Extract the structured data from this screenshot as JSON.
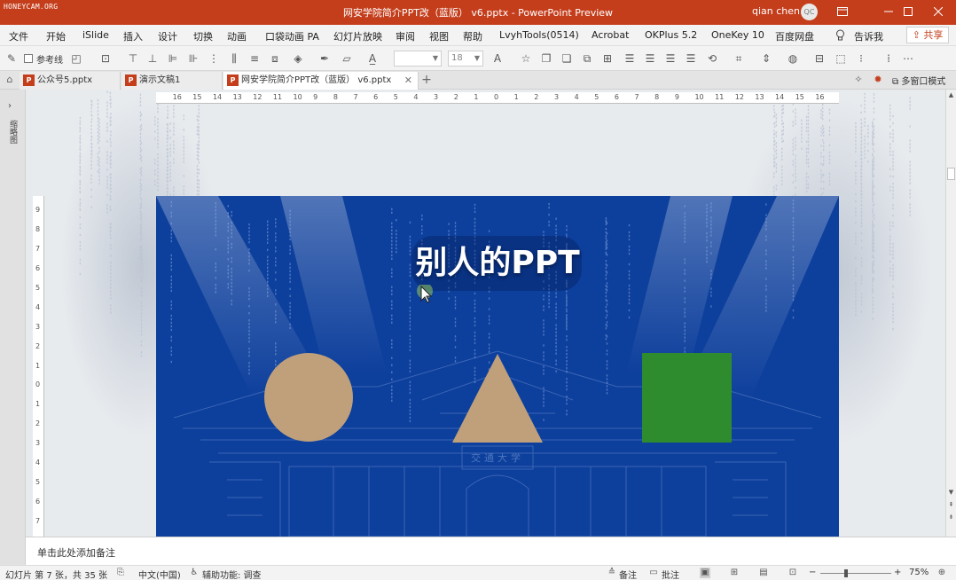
{
  "brand_text": "HONEYCAM.ORG",
  "window": {
    "title": "网安学院简介PPT改（蓝版） v6.pptx - PowerPoint Preview",
    "user": "qian chen",
    "avatar": "QC",
    "min_icon": "minimize-icon",
    "max_icon": "maximize-icon",
    "close_icon": "close-icon"
  },
  "menu": {
    "items": [
      "文件",
      "开始",
      "iSlide",
      "插入",
      "设计",
      "切换",
      "动画",
      "口袋动画 PA",
      "幻灯片放映",
      "审阅",
      "视图",
      "帮助",
      "LvyhTools(0514)",
      "Acrobat",
      "OKPlus 5.2",
      "OneKey 10",
      "百度网盘"
    ],
    "tell_me": "告诉我",
    "share": "共享"
  },
  "toolbar": {
    "guides_label": "参考线",
    "font_size": "18"
  },
  "tabs": [
    {
      "label": "公众号5.pptx",
      "active": false
    },
    {
      "label": "演示文稿1",
      "active": false
    },
    {
      "label": "网安学院简介PPT改（蓝版） v6.pptx",
      "active": true
    }
  ],
  "tabs_right": {
    "multi_window": "多窗口模式"
  },
  "left_pane": {
    "label": "缩略图"
  },
  "ruler": {
    "h_numbers": [
      "16",
      "15",
      "14",
      "13",
      "12",
      "11",
      "10",
      "9",
      "8",
      "7",
      "6",
      "5",
      "4",
      "3",
      "2",
      "1",
      "0",
      "1",
      "2",
      "3",
      "4",
      "5",
      "6",
      "7",
      "8",
      "9",
      "10",
      "11",
      "12",
      "13",
      "14",
      "15",
      "16"
    ],
    "v_numbers": [
      "9",
      "8",
      "7",
      "6",
      "5",
      "4",
      "3",
      "2",
      "1",
      "0",
      "1",
      "2",
      "3",
      "4",
      "5",
      "6",
      "7"
    ]
  },
  "slide": {
    "title": "别人的PPT",
    "background": "#0d3f9c",
    "shapes": [
      {
        "type": "circle",
        "color": "#c0a07a"
      },
      {
        "type": "triangle",
        "color": "#c0a07a"
      },
      {
        "type": "square",
        "color": "#2e8b2e"
      }
    ],
    "building_sign": "交通大学"
  },
  "notes": {
    "placeholder": "单击此处添加备注"
  },
  "status": {
    "slide_info": "幻灯片 第 7 张，共 35 张",
    "language": "中文(中国)",
    "accessibility": "辅助功能: 调查",
    "notes_btn": "备注",
    "comments_btn": "批注",
    "zoom": "75%"
  },
  "colors": {
    "titlebar": "#c43e1c",
    "slide_bg": "#0d3f9c",
    "shape_tan": "#c0a07a",
    "shape_green": "#2e8b2e"
  }
}
